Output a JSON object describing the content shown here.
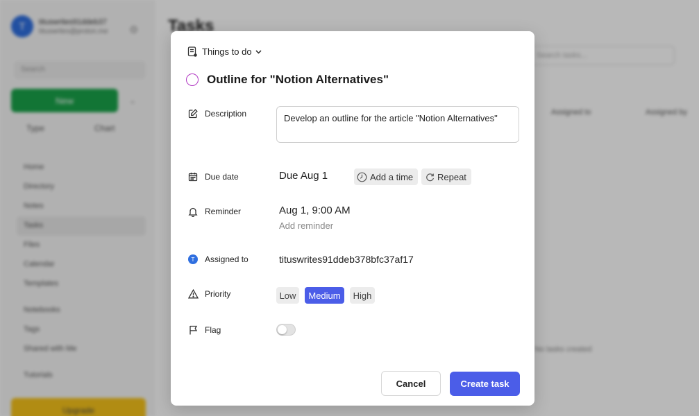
{
  "background": {
    "sidebar": {
      "avatar_initial": "T",
      "account_name": "tituswrites91ddeb37",
      "account_email": "tituswrites@proton.me",
      "search_placeholder": "Search",
      "new_label": "New",
      "type_label": "Type",
      "chart_label": "Chart",
      "nav_items": [
        "Home",
        "Directory",
        "Notes",
        "Tasks",
        "Files",
        "Calendar",
        "Templates"
      ],
      "nav_items_2": [
        "Notebooks",
        "Tags",
        "Shared with Me"
      ],
      "tutorials_label": "Tutorials",
      "upgrade_label": "Upgrade"
    },
    "main": {
      "page_title": "Tasks",
      "search_placeholder": "Search tasks...",
      "col_assigned_to": "Assigned to",
      "col_assigned_by": "Assigned by",
      "empty_text": "No tasks created"
    }
  },
  "modal": {
    "list_name": "Things to do",
    "task_title": "Outline for \"Notion Alternatives\"",
    "labels": {
      "description": "Description",
      "due_date": "Due date",
      "reminder": "Reminder",
      "assigned_to": "Assigned to",
      "priority": "Priority",
      "flag": "Flag"
    },
    "description_value": "Develop an outline for the article \"Notion Alternatives\"",
    "due_value": "Due Aug 1",
    "add_time_label": "Add a time",
    "repeat_label": "Repeat",
    "reminder_value": "Aug 1, 9:00 AM",
    "add_reminder_label": "Add reminder",
    "assignee_initial": "T",
    "assignee_name": "tituswrites91ddeb378bfc37af17",
    "priority_options": [
      "Low",
      "Medium",
      "High"
    ],
    "priority_selected": "Medium",
    "flag_on": false,
    "cancel_label": "Cancel",
    "create_label": "Create task"
  },
  "colors": {
    "accent": "#4b5de8",
    "task_circle": "#b23ac4",
    "avatar": "#2f6fe0",
    "new_button": "#1aa34a",
    "upgrade_button": "#f5c21b"
  }
}
